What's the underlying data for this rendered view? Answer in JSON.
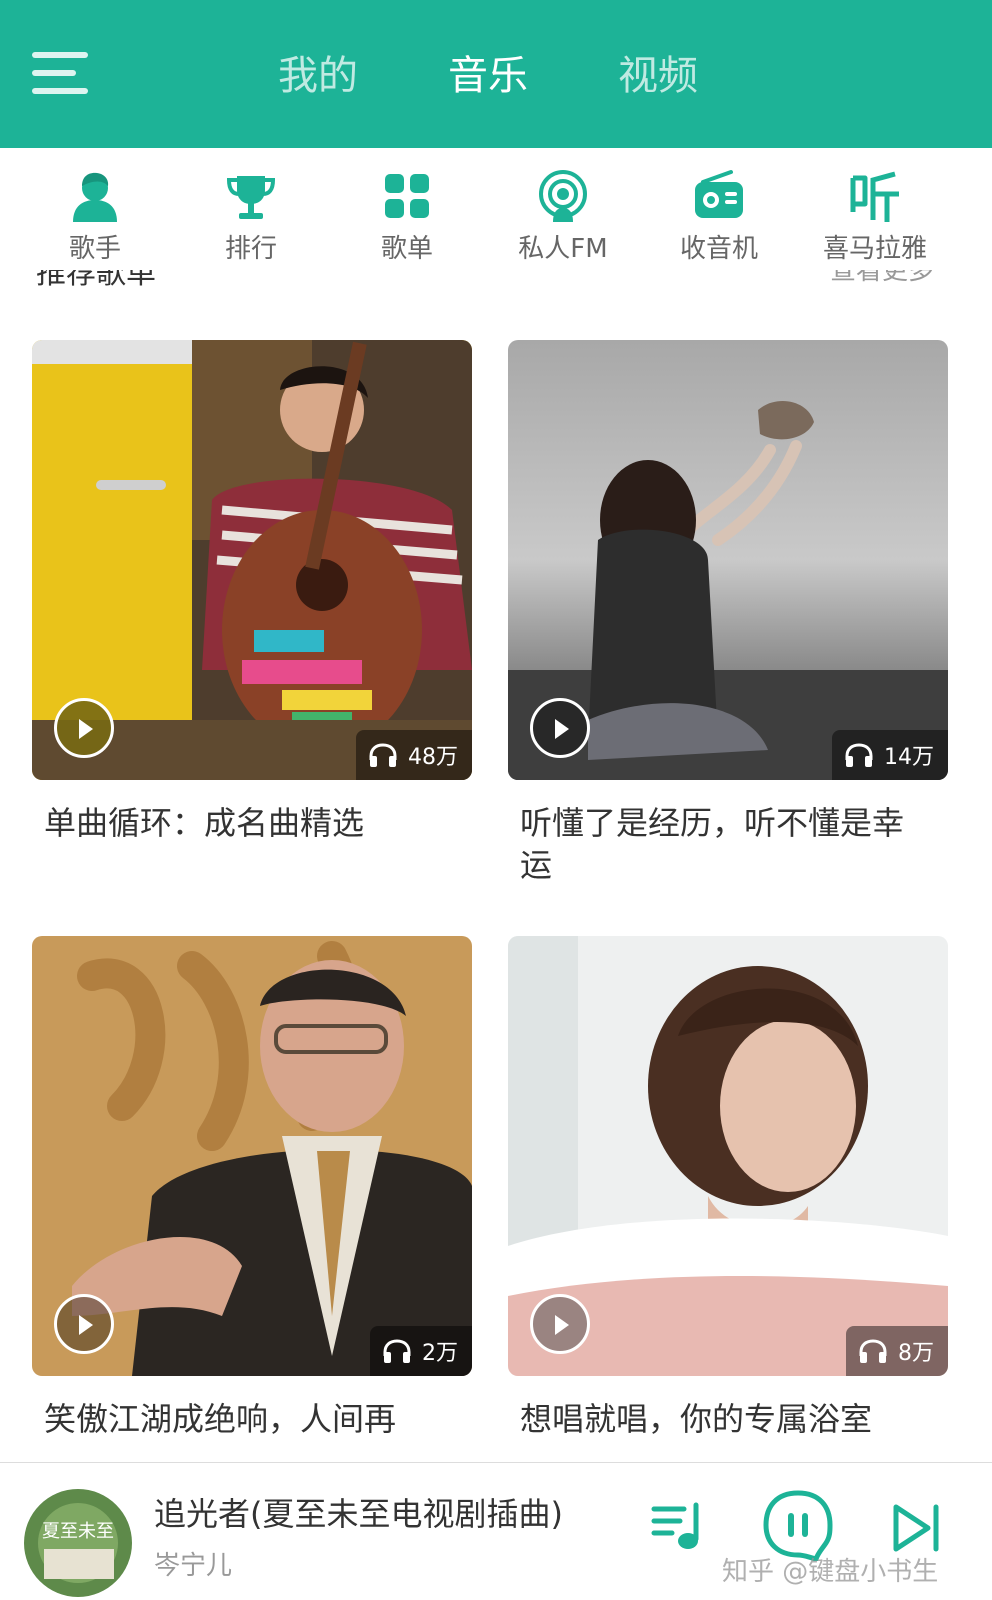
{
  "header": {
    "menu_icon": "hamburger-menu-icon",
    "tabs": [
      {
        "label": "我的",
        "active": false
      },
      {
        "label": "音乐",
        "active": true
      },
      {
        "label": "视频",
        "active": false
      }
    ],
    "accent_color": "#1db397"
  },
  "categories": [
    {
      "label": "歌手",
      "icon": "singer-icon"
    },
    {
      "label": "排行",
      "icon": "trophy-icon"
    },
    {
      "label": "歌单",
      "icon": "grid-icon"
    },
    {
      "label": "私人FM",
      "icon": "podcast-icon"
    },
    {
      "label": "收音机",
      "icon": "radio-icon"
    },
    {
      "label": "喜马拉雅",
      "icon": "listen-icon"
    }
  ],
  "section_peek": {
    "left": "推荐歌单",
    "right": "查看更多"
  },
  "playlists": [
    {
      "title": "单曲循环：成名曲精选",
      "plays": "48万"
    },
    {
      "title": "听懂了是经历，听不懂是幸运",
      "plays": "14万"
    },
    {
      "title": "笑傲江湖成绝响，人间再",
      "plays": "2万"
    },
    {
      "title": "想唱就唱，你的专属浴室",
      "plays": "8万"
    }
  ],
  "player": {
    "song": "追光者(夏至未至电视剧插曲)",
    "artist": "岑宁儿",
    "cover_text": "夏至未至"
  },
  "watermark": "知乎 @键盘小书生"
}
